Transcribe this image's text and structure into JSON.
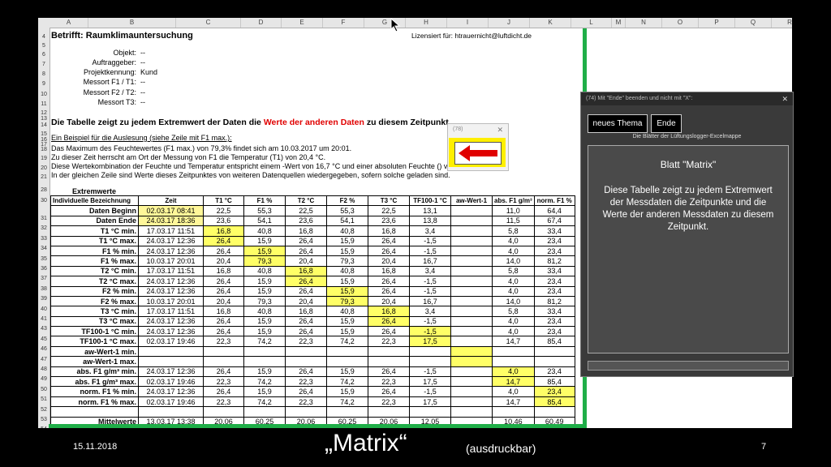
{
  "columns": [
    "A",
    "B",
    "C",
    "D",
    "E",
    "F",
    "G",
    "H",
    "I",
    "J",
    "K",
    "L",
    "M",
    "N",
    "O",
    "P",
    "Q",
    "R",
    "S"
  ],
  "header": {
    "subject": "Betrifft: Raumklimauntersuchung",
    "license": "Lizensiert für: htrauernicht@luftdicht.de",
    "fields": [
      {
        "row": "6",
        "label": "Objekt:",
        "value": "--"
      },
      {
        "row": "7",
        "label": "Auftraggeber:",
        "value": "--"
      },
      {
        "row": "8",
        "label": "Projektkennung:",
        "value": "Kund"
      },
      {
        "row": "9",
        "label": "Messort  F1 / T1:",
        "value": "--"
      },
      {
        "row": "10",
        "label": "Messort  F2 / T2:",
        "value": "--"
      },
      {
        "row": "11",
        "label": "Messort  T3:",
        "value": "--"
      }
    ],
    "headline_a": "Die Tabelle zeigt zu jedem Extremwert der Daten die ",
    "headline_red": "Werte der anderen Daten",
    "headline_b": " zu diesem Zeitpunkt.",
    "example_title": "Ein Beispiel für die Auslesung (siehe Zeile mit F1 max.):",
    "lines": [
      "Das Maximum des Feuchtewertes (F1 max.) von 79,3% findet sich am 10.03.2017 um 20:01.",
      "Zu dieser Zeit herrscht am Ort der Messung von F1 die Temperatur (T1) von 20,4 °C.",
      "Diese Wertekombination der Feuchte und Temperatur entspricht einem -Wert von 16,7 °C und einer absoluten Feuchte () von 14 g/m³.",
      "In der gleichen Zeile sind Werte dieses Zeitpunktes von weiteren Datenquellen wiedergegeben, sofern solche geladen sind."
    ]
  },
  "table": {
    "title": "Extremwerte",
    "headers": [
      "Individuelle Bezeichnung",
      "Zeit",
      "T1 °C",
      "F1 %",
      "T2 °C",
      "F2 %",
      "T3 °C",
      "TF100-1 °C",
      "aw-Wert-1",
      "abs. F1 g/m³",
      "norm. F1 %"
    ],
    "rows": [
      {
        "n": "31",
        "cells": [
          "Daten Beginn",
          "02.03.17 08:41",
          "22,5",
          "55,3",
          "22,5",
          "55,3",
          "22,5",
          "13,1",
          "",
          "11,0",
          "64,4"
        ],
        "hl": [
          1
        ]
      },
      {
        "n": "32",
        "cells": [
          "Daten Ende",
          "24.03.17 18:36",
          "23,6",
          "54,1",
          "23,6",
          "54,1",
          "23,6",
          "13,8",
          "",
          "11,5",
          "67,4"
        ],
        "hl": [
          1
        ]
      },
      {
        "n": "33",
        "cells": [
          "T1 °C min.",
          "17.03.17 11:51",
          "16,8",
          "40,8",
          "16,8",
          "40,8",
          "16,8",
          "3,4",
          "",
          "5,8",
          "33,4"
        ],
        "hl": [
          2
        ]
      },
      {
        "n": "34",
        "cells": [
          "T1 °C max.",
          "24.03.17 12:36",
          "26,4",
          "15,9",
          "26,4",
          "15,9",
          "26,4",
          "-1,5",
          "",
          "4,0",
          "23,4"
        ],
        "hl": [
          2
        ]
      },
      {
        "n": "35",
        "cells": [
          "F1 % min.",
          "24.03.17 12:36",
          "26,4",
          "15,9",
          "26,4",
          "15,9",
          "26,4",
          "-1,5",
          "",
          "4,0",
          "23,4"
        ],
        "hl": [
          3
        ]
      },
      {
        "n": "36",
        "cells": [
          "F1 % max.",
          "10.03.17 20:01",
          "20,4",
          "79,3",
          "20,4",
          "79,3",
          "20,4",
          "16,7",
          "",
          "14,0",
          "81,2"
        ],
        "hl": [
          3
        ]
      },
      {
        "n": "37",
        "cells": [
          "T2 °C min.",
          "17.03.17 11:51",
          "16,8",
          "40,8",
          "16,8",
          "40,8",
          "16,8",
          "3,4",
          "",
          "5,8",
          "33,4"
        ],
        "hl": [
          4
        ]
      },
      {
        "n": "38",
        "cells": [
          "T2 °C max.",
          "24.03.17 12:36",
          "26,4",
          "15,9",
          "26,4",
          "15,9",
          "26,4",
          "-1,5",
          "",
          "4,0",
          "23,4"
        ],
        "hl": [
          4
        ]
      },
      {
        "n": "39",
        "cells": [
          "F2 % min.",
          "24.03.17 12:36",
          "26,4",
          "15,9",
          "26,4",
          "15,9",
          "26,4",
          "-1,5",
          "",
          "4,0",
          "23,4"
        ],
        "hl": [
          5
        ]
      },
      {
        "n": "40",
        "cells": [
          "F2 % max.",
          "10.03.17 20:01",
          "20,4",
          "79,3",
          "20,4",
          "79,3",
          "20,4",
          "16,7",
          "",
          "14,0",
          "81,2"
        ],
        "hl": [
          5
        ]
      },
      {
        "n": "41",
        "cells": [
          "T3 °C min.",
          "17.03.17 11:51",
          "16,8",
          "40,8",
          "16,8",
          "40,8",
          "16,8",
          "3,4",
          "",
          "5,8",
          "33,4"
        ],
        "hl": [
          6
        ]
      },
      {
        "n": "43",
        "cells": [
          "T3 °C max.",
          "24.03.17 12:36",
          "26,4",
          "15,9",
          "26,4",
          "15,9",
          "26,4",
          "-1,5",
          "",
          "4,0",
          "23,4"
        ],
        "hl": [
          6
        ]
      },
      {
        "n": "45",
        "cells": [
          "TF100-1 °C min.",
          "24.03.17 12:36",
          "26,4",
          "15,9",
          "26,4",
          "15,9",
          "26,4",
          "-1,5",
          "",
          "4,0",
          "23,4"
        ],
        "hl": [
          7
        ]
      },
      {
        "n": "46",
        "cells": [
          "TF100-1 °C max.",
          "02.03.17 19:46",
          "22,3",
          "74,2",
          "22,3",
          "74,2",
          "22,3",
          "17,5",
          "",
          "14,7",
          "85,4"
        ],
        "hl": [
          7
        ]
      },
      {
        "n": "47",
        "cells": [
          "aw-Wert-1 min.",
          "",
          "",
          "",
          "",
          "",
          "",
          "",
          "",
          "",
          ""
        ],
        "hl": [
          8
        ]
      },
      {
        "n": "48",
        "cells": [
          "aw-Wert-1 max.",
          "",
          "",
          "",
          "",
          "",
          "",
          "",
          "",
          "",
          ""
        ],
        "hl": [
          8
        ]
      },
      {
        "n": "49",
        "cells": [
          "abs. F1 g/m³ min.",
          "24.03.17 12:36",
          "26,4",
          "15,9",
          "26,4",
          "15,9",
          "26,4",
          "-1,5",
          "",
          "4,0",
          "23,4"
        ],
        "hl": [
          9
        ]
      },
      {
        "n": "50",
        "cells": [
          "abs. F1 g/m³ max.",
          "02.03.17 19:46",
          "22,3",
          "74,2",
          "22,3",
          "74,2",
          "22,3",
          "17,5",
          "",
          "14,7",
          "85,4"
        ],
        "hl": [
          9
        ]
      },
      {
        "n": "51",
        "cells": [
          "norm. F1 % min.",
          "24.03.17 12:36",
          "26,4",
          "15,9",
          "26,4",
          "15,9",
          "26,4",
          "-1,5",
          "",
          "4,0",
          "23,4"
        ],
        "hl": [
          10
        ]
      },
      {
        "n": "52",
        "cells": [
          "norm. F1 % max.",
          "02.03.17 19:46",
          "22,3",
          "74,2",
          "22,3",
          "74,2",
          "22,3",
          "17,5",
          "",
          "14,7",
          "85,4"
        ],
        "hl": [
          10
        ]
      },
      {
        "n": "53",
        "cells": [
          "",
          "",
          "",
          "",
          "",
          "",
          "",
          "",
          "",
          "",
          ""
        ],
        "hl": []
      },
      {
        "n": "54",
        "cells": [
          "Mittelwerte",
          "13.03.17 13:38",
          "20,06",
          "60,25",
          "20,06",
          "60,25",
          "20,06",
          "12,05",
          "",
          "10,46",
          "60,49"
        ],
        "hl": []
      }
    ]
  },
  "msgbox": {
    "title": "(78)",
    "close": "✕"
  },
  "panel": {
    "title": "(74)                      Mit \"Ende\" beenden und nicht mit \"X\":",
    "close": "✕",
    "btn_new": "neues Thema",
    "btn_end": "Ende",
    "subtitle": "Die Blätter der Lüftungslogger-Excelmappe",
    "sheet_name": "Blatt \"Matrix\"",
    "description": "Diese Tabelle zeigt zu jedem Extremwert der Messdaten die Zeitpunkte und die Werte der anderen Messdaten zu diesem Zeitpunkt."
  },
  "footer": {
    "date": "15.11.2018",
    "title": "„Matrix“",
    "subtitle": "(ausdruckbar)",
    "page": "7"
  },
  "colors": {
    "green": "#1fae48",
    "yellow": "#ffff66",
    "red": "#e00000"
  }
}
